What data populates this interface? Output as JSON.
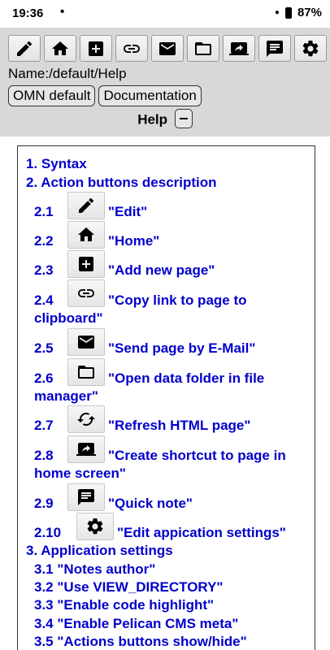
{
  "status": {
    "time": "19:36",
    "dot": "•",
    "battery": "87%"
  },
  "toolbar": {
    "buttons": [
      {
        "icon": "edit-icon"
      },
      {
        "icon": "home-icon"
      },
      {
        "icon": "add-box-icon"
      },
      {
        "icon": "link-icon"
      },
      {
        "icon": "mail-icon"
      },
      {
        "icon": "folder-icon"
      },
      {
        "icon": "shortcut-icon"
      },
      {
        "icon": "note-icon"
      },
      {
        "icon": "gear-icon"
      }
    ]
  },
  "header": {
    "name_path": "Name:/default/Help",
    "omn_default": "OMN default",
    "documentation": "Documentation",
    "help_title": "Help"
  },
  "toc": {
    "s1": "1. Syntax",
    "s2": "2. Action buttons description",
    "items": [
      {
        "num": "2.1",
        "text": "\"Edit\""
      },
      {
        "num": "2.2",
        "text": "\"Home\""
      },
      {
        "num": "2.3",
        "text": "\"Add new page\""
      },
      {
        "num": "2.4",
        "text": "\"Copy link to page to",
        "text2": "clipboard\""
      },
      {
        "num": "2.5",
        "text": "\"Send page by E-Mail\""
      },
      {
        "num": "2.6",
        "text": "\"Open data folder in file",
        "text2": "manager\""
      },
      {
        "num": "2.7",
        "text": "\"Refresh HTML page\""
      },
      {
        "num": "2.8",
        "text": "\"Create shortcut to page in",
        "text2": "home screen\""
      },
      {
        "num": "2.9",
        "text": "\"Quick note\""
      },
      {
        "num": "2.10",
        "text": "\"Edit appication settings\""
      }
    ],
    "s3": "3. Application settings",
    "sub3": [
      "3.1 \"Notes author\"",
      "3.2 \"Use VIEW_DIRECTORY\"",
      "3.3 \"Enable code highlight\"",
      "3.4 \"Enable Pelican CMS meta\"",
      "3.5 \"Actions buttons show/hide\""
    ]
  }
}
